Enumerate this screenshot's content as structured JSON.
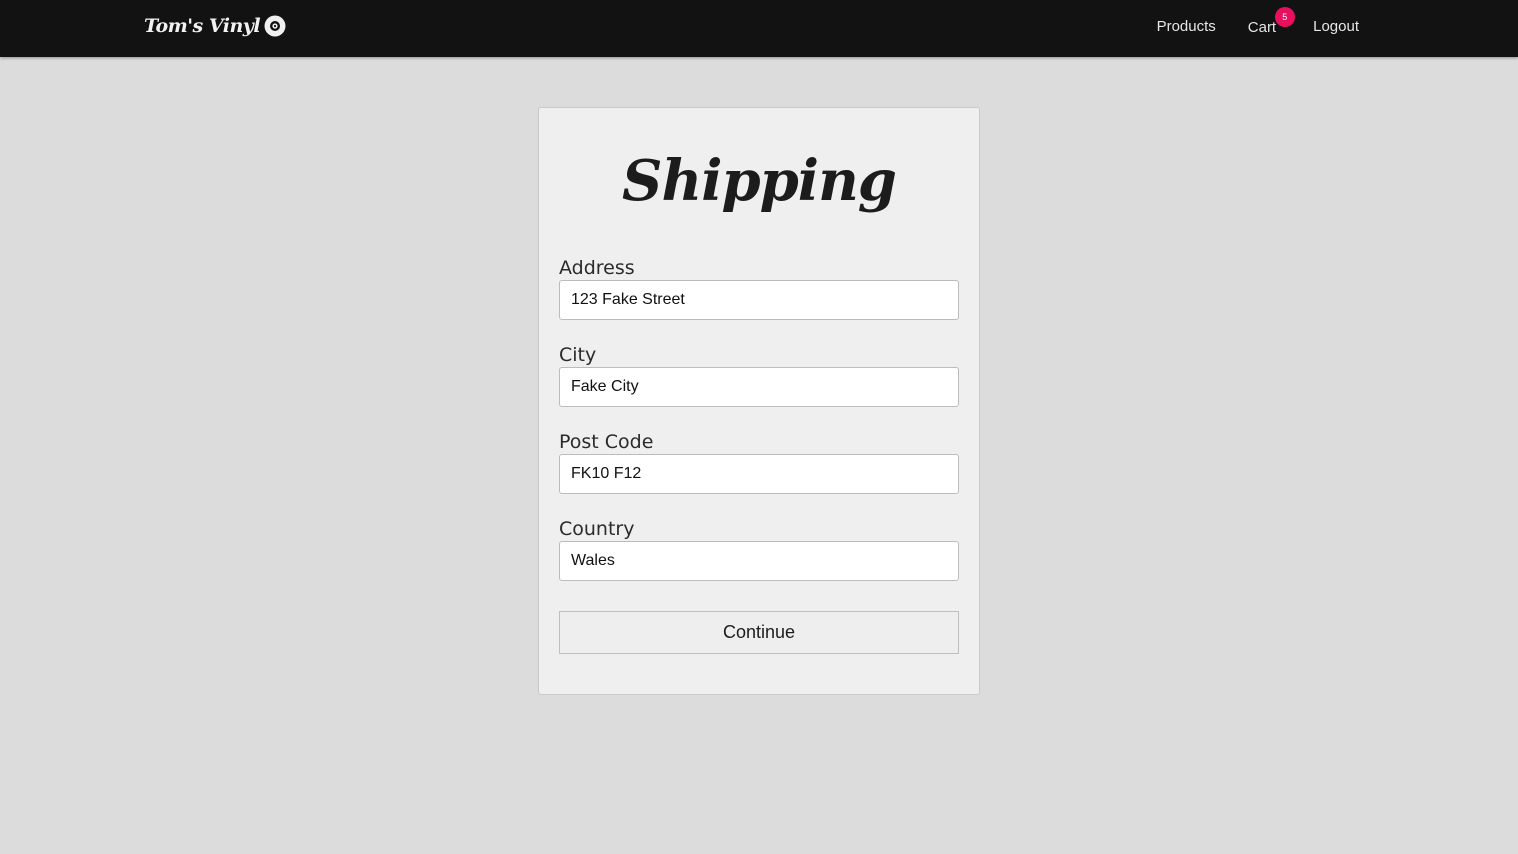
{
  "navbar": {
    "brand": "Tom's Vinyl",
    "brand_icon": "vinyl-record-icon",
    "links": {
      "products": "Products",
      "cart": "Cart",
      "logout": "Logout"
    },
    "cart_count": "5",
    "badge_color": "#e8105e"
  },
  "form": {
    "title": "Shipping",
    "fields": {
      "address": {
        "label": "Address",
        "value": "123 Fake Street"
      },
      "city": {
        "label": "City",
        "value": "Fake City"
      },
      "postcode": {
        "label": "Post Code",
        "value": "FK10 F12"
      },
      "country": {
        "label": "Country",
        "value": "Wales"
      }
    },
    "submit_label": "Continue"
  }
}
